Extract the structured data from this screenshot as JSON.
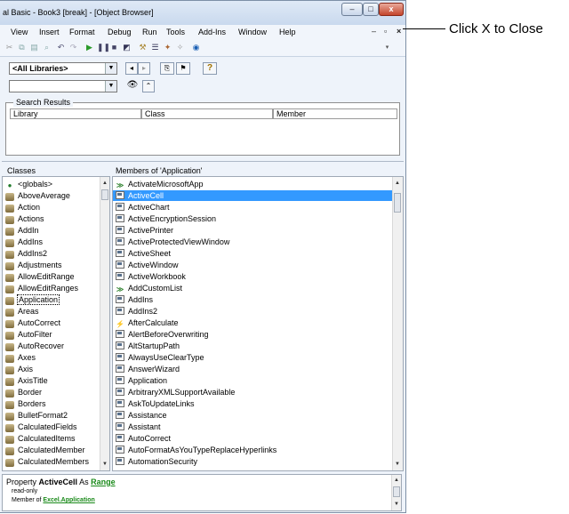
{
  "window": {
    "title": "al Basic - Book3 [break] - [Object Browser]",
    "controls": {
      "minimize": "–",
      "maximize": "□",
      "close": "x"
    }
  },
  "menubar": {
    "items": [
      "View",
      "Insert",
      "Format",
      "Debug",
      "Run",
      "Tools",
      "Add-Ins",
      "Window",
      "Help"
    ],
    "mdi_controls": {
      "minimize": "–",
      "restore": "ꟷ",
      "close": "×"
    }
  },
  "browser": {
    "library_combo": "<All Libraries>",
    "search_combo": "",
    "help_button": "?"
  },
  "search_results": {
    "label": "Search Results",
    "columns": [
      "Library",
      "Class",
      "Member"
    ]
  },
  "classes": {
    "header": "Classes",
    "items": [
      {
        "label": "<globals>",
        "icon": "globals-icon"
      },
      {
        "label": "AboveAverage",
        "icon": "class-icon"
      },
      {
        "label": "Action",
        "icon": "class-icon"
      },
      {
        "label": "Actions",
        "icon": "class-icon"
      },
      {
        "label": "AddIn",
        "icon": "class-icon"
      },
      {
        "label": "AddIns",
        "icon": "class-icon"
      },
      {
        "label": "AddIns2",
        "icon": "class-icon"
      },
      {
        "label": "Adjustments",
        "icon": "class-icon"
      },
      {
        "label": "AllowEditRange",
        "icon": "class-icon"
      },
      {
        "label": "AllowEditRanges",
        "icon": "class-icon"
      },
      {
        "label": "Application",
        "icon": "class-icon"
      },
      {
        "label": "Areas",
        "icon": "class-icon"
      },
      {
        "label": "AutoCorrect",
        "icon": "class-icon"
      },
      {
        "label": "AutoFilter",
        "icon": "class-icon"
      },
      {
        "label": "AutoRecover",
        "icon": "class-icon"
      },
      {
        "label": "Axes",
        "icon": "class-icon"
      },
      {
        "label": "Axis",
        "icon": "class-icon"
      },
      {
        "label": "AxisTitle",
        "icon": "class-icon"
      },
      {
        "label": "Border",
        "icon": "class-icon"
      },
      {
        "label": "Borders",
        "icon": "class-icon"
      },
      {
        "label": "BulletFormat2",
        "icon": "class-icon"
      },
      {
        "label": "CalculatedFields",
        "icon": "class-icon"
      },
      {
        "label": "CalculatedItems",
        "icon": "class-icon"
      },
      {
        "label": "CalculatedMember",
        "icon": "class-icon"
      },
      {
        "label": "CalculatedMembers",
        "icon": "class-icon"
      }
    ],
    "focused_index": 10
  },
  "members": {
    "header": "Members of 'Application'",
    "items": [
      {
        "label": "ActivateMicrosoftApp",
        "icon": "method-icon"
      },
      {
        "label": "ActiveCell",
        "icon": "property-icon"
      },
      {
        "label": "ActiveChart",
        "icon": "property-icon"
      },
      {
        "label": "ActiveEncryptionSession",
        "icon": "property-icon"
      },
      {
        "label": "ActivePrinter",
        "icon": "property-icon"
      },
      {
        "label": "ActiveProtectedViewWindow",
        "icon": "property-icon"
      },
      {
        "label": "ActiveSheet",
        "icon": "property-icon"
      },
      {
        "label": "ActiveWindow",
        "icon": "property-icon"
      },
      {
        "label": "ActiveWorkbook",
        "icon": "property-icon"
      },
      {
        "label": "AddCustomList",
        "icon": "method-icon"
      },
      {
        "label": "AddIns",
        "icon": "property-icon"
      },
      {
        "label": "AddIns2",
        "icon": "property-icon"
      },
      {
        "label": "AfterCalculate",
        "icon": "event-icon"
      },
      {
        "label": "AlertBeforeOverwriting",
        "icon": "property-icon"
      },
      {
        "label": "AltStartupPath",
        "icon": "property-icon"
      },
      {
        "label": "AlwaysUseClearType",
        "icon": "property-icon"
      },
      {
        "label": "AnswerWizard",
        "icon": "property-icon"
      },
      {
        "label": "Application",
        "icon": "property-icon"
      },
      {
        "label": "ArbitraryXMLSupportAvailable",
        "icon": "property-icon"
      },
      {
        "label": "AskToUpdateLinks",
        "icon": "property-icon"
      },
      {
        "label": "Assistance",
        "icon": "property-icon"
      },
      {
        "label": "Assistant",
        "icon": "property-icon"
      },
      {
        "label": "AutoCorrect",
        "icon": "property-icon"
      },
      {
        "label": "AutoFormatAsYouTypeReplaceHyperlinks",
        "icon": "property-icon"
      },
      {
        "label": "AutomationSecurity",
        "icon": "property-icon"
      }
    ],
    "selected_index": 1
  },
  "details": {
    "prefix": "Property",
    "member": "ActiveCell",
    "as_word": "As",
    "type_link": "Range",
    "line2": "read-only",
    "line3_prefix": "Member of",
    "line3_link": "Excel.Application"
  },
  "callout": {
    "text": "Click X to Close"
  },
  "colors": {
    "selection": "#3399ff",
    "link": "#1a8a1a",
    "close_button": "#c4452c"
  }
}
